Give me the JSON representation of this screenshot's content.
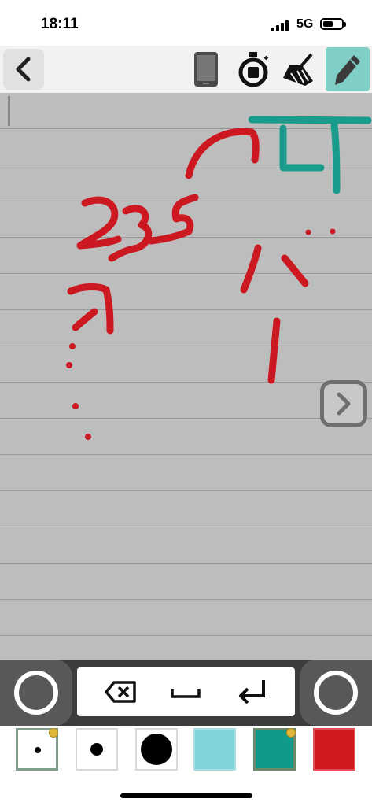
{
  "status": {
    "time": "18:11",
    "network": "5G"
  },
  "toolbar": {
    "back": "chevron-left-icon",
    "buttons": [
      "phone-icon",
      "stopwatch-icon",
      "broom-icon",
      "pencil-icon"
    ],
    "active_button": "pencil-icon"
  },
  "canvas": {
    "next": "chevron-right-icon"
  },
  "keypad": {
    "left_round": "circle-icon",
    "right_round": "circle-icon",
    "keys": [
      "backspace-icon",
      "space-icon",
      "return-icon"
    ]
  },
  "palette": {
    "colors": {
      "background": "#bdbdbd",
      "ink_red": "#cc1820",
      "ink_teal": "#1a9c8c",
      "pen_active": "#7fcfc6",
      "light_cyan": "#7fd5da",
      "teal": "#109a8a",
      "red": "#d01820"
    },
    "swatches": [
      "pen-size-small",
      "pen-size-medium",
      "pen-size-large",
      "color-light-cyan",
      "color-teal",
      "color-red"
    ],
    "selected_size": "pen-size-small",
    "selected_color": "color-teal"
  }
}
